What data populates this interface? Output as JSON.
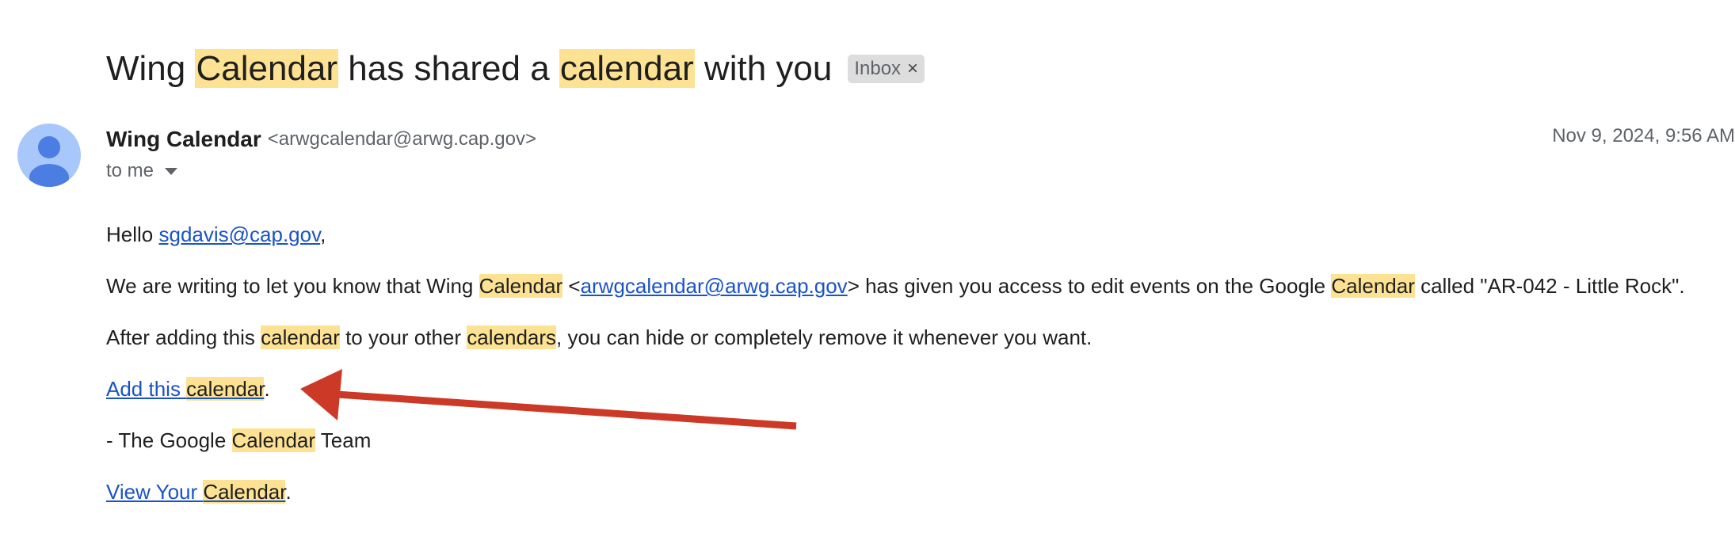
{
  "subject": {
    "part1": "Wing ",
    "hl1": "Calendar",
    "part2": " has shared a ",
    "hl2": "calendar",
    "part3": " with you",
    "label_chip": "Inbox",
    "label_remove": "×"
  },
  "sender": {
    "name": "Wing Calendar",
    "email": "<arwgcalendar@arwg.cap.gov>",
    "date": "Nov 9, 2024, 9:56 AM",
    "to": "to me",
    "avatar_color": "#a8c7fa",
    "avatar_icon": "person-icon"
  },
  "body": {
    "greeting_prefix": "Hello ",
    "greeting_email": "sgdavis@cap.gov",
    "greeting_suffix": ",",
    "p1": {
      "a": "We are writing to let you know that Wing ",
      "hl1": "Calendar",
      "b": " <",
      "link": "arwgcalendar@arwg.cap.gov",
      "c": "> has given you access to edit events on the Google ",
      "hl2": "Calendar",
      "d": " called \"AR-042 - Little Rock\"."
    },
    "p2": {
      "a": "After adding this ",
      "hl1": "calendar",
      "b": " to your other ",
      "hl2": "calendars",
      "c": ", you can hide or completely remove it whenever you want."
    },
    "add_link": {
      "a": "Add this ",
      "hl": "calendar",
      "suffix": "."
    },
    "signoff": {
      "a": "- The Google ",
      "hl": "Calendar",
      "b": " Team"
    },
    "view_link": {
      "a": "View Your ",
      "hl": "Calendar",
      "suffix": "."
    }
  },
  "annotation": {
    "arrow_color": "#cc3a27",
    "arrow_target": "add-calendar-link"
  },
  "colors": {
    "highlight": "#fde293",
    "link": "#1a53c7",
    "text": "#1f1f1f",
    "muted": "#5f6368"
  }
}
